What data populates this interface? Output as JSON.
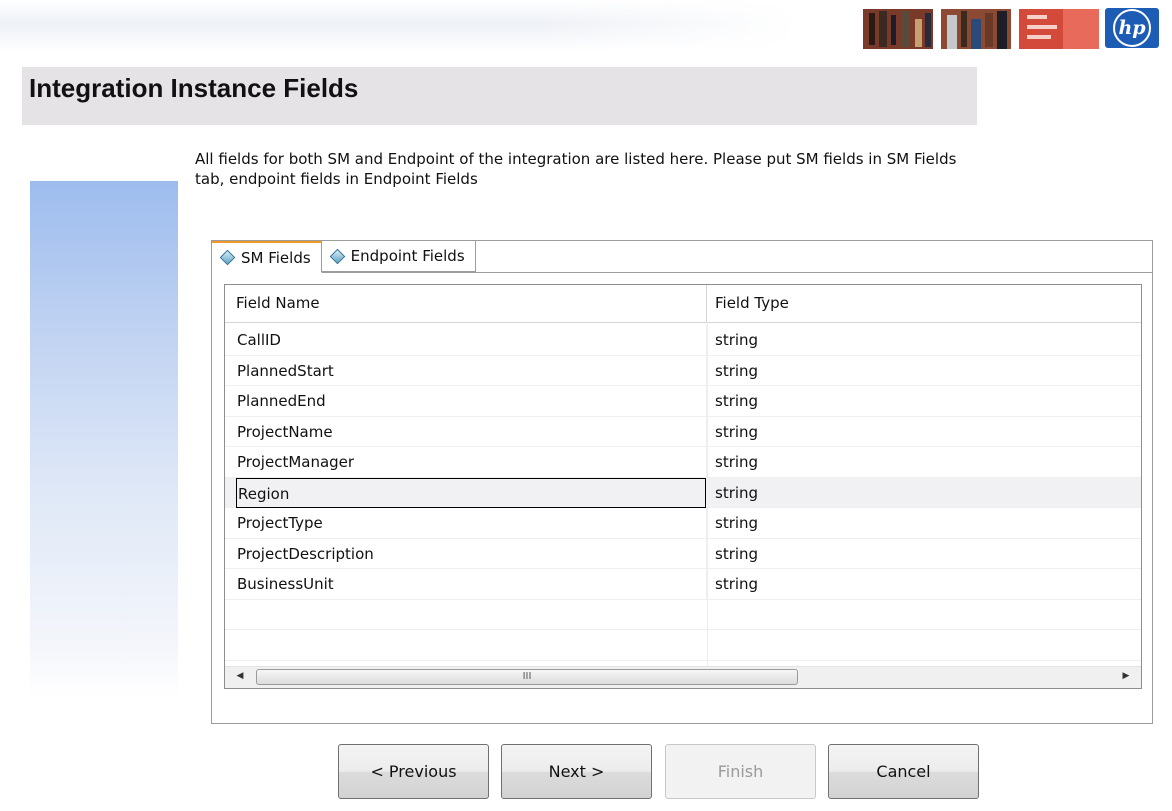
{
  "header": {
    "title": "Integration Instance Fields",
    "logo_text": "hp"
  },
  "description": "All fields for both SM and Endpoint of the integration are listed here.  Please put SM fields in SM Fields tab, endpoint fields in Endpoint Fields",
  "tabs": [
    {
      "label": "SM Fields",
      "active": true
    },
    {
      "label": "Endpoint Fields",
      "active": false
    }
  ],
  "table": {
    "columns": [
      "Field Name",
      "Field Type"
    ],
    "rows": [
      {
        "name": "CallID",
        "type": "string"
      },
      {
        "name": "PlannedStart",
        "type": "string"
      },
      {
        "name": "PlannedEnd",
        "type": "string"
      },
      {
        "name": "ProjectName",
        "type": "string"
      },
      {
        "name": "ProjectManager",
        "type": "string"
      },
      {
        "name": "Region",
        "type": "string",
        "editing": true
      },
      {
        "name": "ProjectType",
        "type": "string"
      },
      {
        "name": "ProjectDescription",
        "type": "string"
      },
      {
        "name": "BusinessUnit",
        "type": "string"
      }
    ],
    "scrollbar_grip": "III"
  },
  "buttons": {
    "previous": "< Previous",
    "next": "Next >",
    "finish": "Finish",
    "cancel": "Cancel"
  },
  "colors": {
    "active_tab_accent": "#f09a2c",
    "title_background": "#e6e3e6",
    "hp_blue": "#1d5cb5"
  }
}
